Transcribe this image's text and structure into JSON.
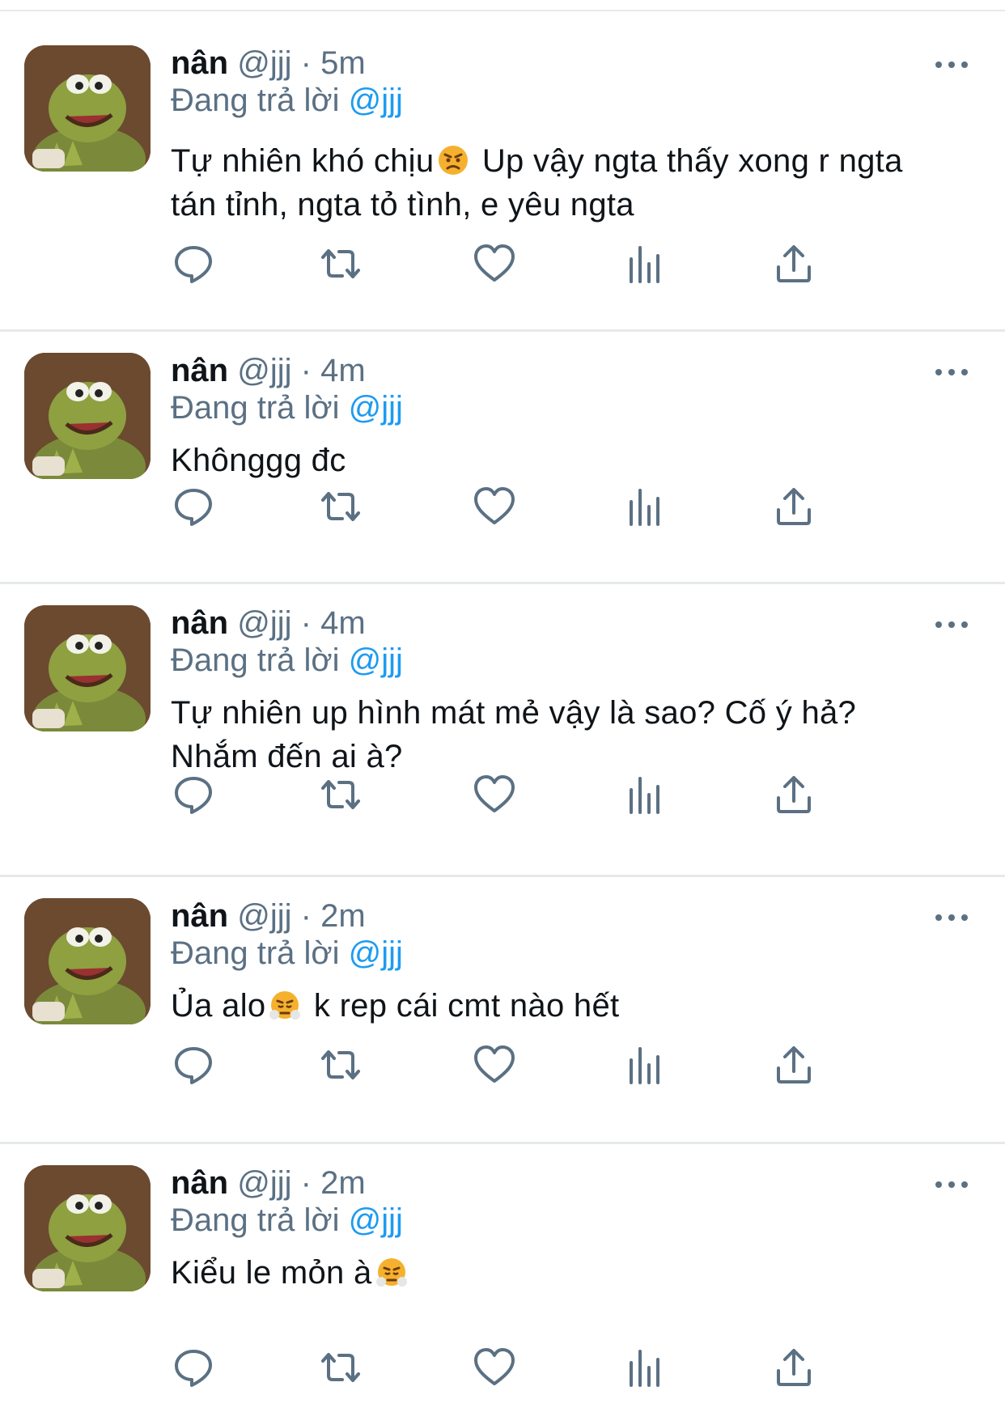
{
  "tweets": [
    {
      "name": "nân",
      "handle": "@jjj",
      "sep": "·",
      "time": "5m",
      "reply_prefix": "Đang trả lời",
      "reply_to": "@jjj",
      "text_a": "Tự nhiên khó chịu",
      "emoji": "angry-face-emoji",
      "text_b": " Up vậy ngta thấy xong r ngta tán tỉnh, ngta tỏ tình, e yêu ngta"
    },
    {
      "name": "nân",
      "handle": "@jjj",
      "sep": "·",
      "time": "4m",
      "reply_prefix": "Đang trả lời",
      "reply_to": "@jjj",
      "text_a": "Khônggg đc",
      "emoji": "",
      "text_b": ""
    },
    {
      "name": "nân",
      "handle": "@jjj",
      "sep": "·",
      "time": "4m",
      "reply_prefix": "Đang trả lời",
      "reply_to": "@jjj",
      "text_a": "Tự nhiên up hình mát mẻ vậy là sao? Cố ý hả? Nhắm đến ai à?",
      "emoji": "",
      "text_b": ""
    },
    {
      "name": "nân",
      "handle": "@jjj",
      "sep": "·",
      "time": "2m",
      "reply_prefix": "Đang trả lời",
      "reply_to": "@jjj",
      "text_a": "Ủa alo",
      "emoji": "steam-nose-face-emoji",
      "text_b": " k rep cái cmt nào hết"
    },
    {
      "name": "nân",
      "handle": "@jjj",
      "sep": "·",
      "time": "2m",
      "reply_prefix": "Đang trả lời",
      "reply_to": "@jjj",
      "text_a": "Kiểu le mỏn à",
      "emoji": "steam-nose-face-emoji",
      "text_b": ""
    }
  ],
  "icons": {
    "more": "more-dots-icon",
    "reply": "reply-bubble-icon",
    "retweet": "retweet-icon",
    "like": "heart-icon",
    "analytics": "analytics-bars-icon",
    "share": "share-upload-icon"
  },
  "colors": {
    "mention": "#1d9bf0",
    "muted": "#5b7083",
    "text": "#0f1419",
    "divider": "#e6e9eb"
  }
}
